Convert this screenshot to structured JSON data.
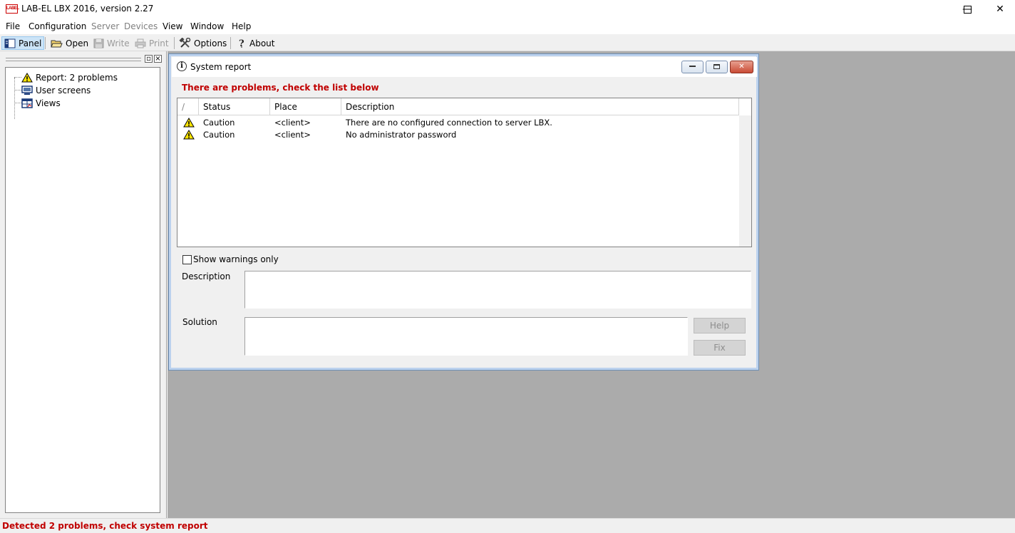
{
  "window": {
    "title": "LAB-EL LBX 2016, version 2.27",
    "logo_text": "LABEL",
    "minimize": "—",
    "maximize": "☐",
    "close": "✕"
  },
  "menu": {
    "items": [
      {
        "label": "File",
        "enabled": true
      },
      {
        "label": "Configuration",
        "enabled": true
      },
      {
        "label": "Server",
        "enabled": false
      },
      {
        "label": "Devices",
        "enabled": false
      },
      {
        "label": "View",
        "enabled": true
      },
      {
        "label": "Window",
        "enabled": true
      },
      {
        "label": "Help",
        "enabled": true
      }
    ]
  },
  "toolbar": {
    "panel": "Panel",
    "open": "Open",
    "write": "Write",
    "print": "Print",
    "options": "Options",
    "about": "About"
  },
  "left_panel": {
    "float_symbol": "▫",
    "close_symbol": "×",
    "tree": [
      {
        "label": "Report: 2 problems",
        "icon": "warning-icon"
      },
      {
        "label": "User screens",
        "icon": "screens-icon"
      },
      {
        "label": "Views",
        "icon": "views-icon"
      }
    ]
  },
  "dialog": {
    "title": "System report",
    "info_symbol": "i",
    "header_message": "There are problems, check the list below",
    "columns": {
      "sort": "/",
      "status": "Status",
      "place": "Place",
      "description": "Description"
    },
    "rows": [
      {
        "status": "Caution",
        "place": "<client>",
        "description": "There are no configured connection to server LBX."
      },
      {
        "status": "Caution",
        "place": "<client>",
        "description": "No administrator password"
      }
    ],
    "show_warnings_only": "Show warnings only",
    "description_label": "Description",
    "solution_label": "Solution",
    "help_button": "Help",
    "fix_button": "Fix"
  },
  "status_bar": {
    "message": "Detected 2 problems, check system report"
  },
  "colors": {
    "alert_red": "#c00000",
    "mdi_background": "#ababab",
    "warning_yellow": "#ffe600"
  }
}
